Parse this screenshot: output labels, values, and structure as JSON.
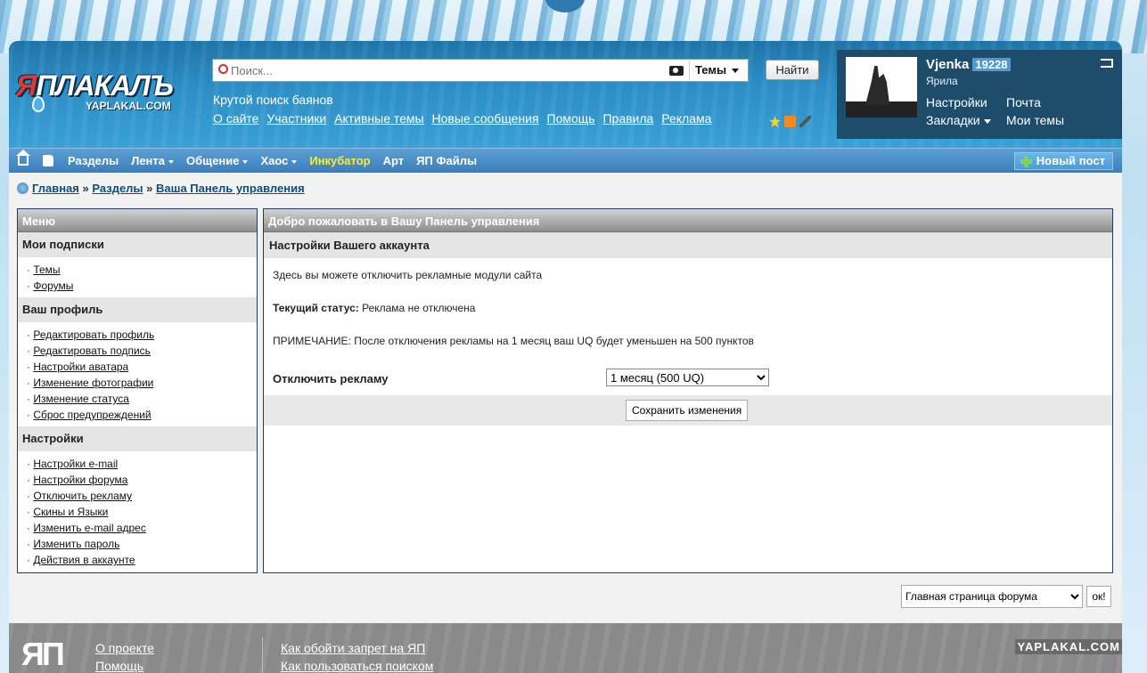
{
  "header": {
    "logo_text_red": "Я",
    "logo_text": "ПЛАКАЛЪ",
    "logo_sub": "YAPLAKAL.COM",
    "search_placeholder": "Поиск...",
    "search_scope": "Темы",
    "search_button": "Найти",
    "tagline": "Крутой поиск баянов",
    "links": [
      "О сайте",
      "Участники",
      "Активные темы",
      "Новые сообщения",
      "Помощь",
      "Правила",
      "Реклама"
    ]
  },
  "user": {
    "name": "Vjenka",
    "reputation": "19228",
    "rank": "Ярила",
    "menu": [
      "Настройки",
      "Почта",
      "Закладки",
      "Мои темы"
    ]
  },
  "nav": {
    "items": [
      {
        "label": "Разделы"
      },
      {
        "label": "Лента"
      },
      {
        "label": "Общение"
      },
      {
        "label": "Хаос"
      },
      {
        "label": "Инкубатор"
      },
      {
        "label": "Арт"
      },
      {
        "label": "ЯП Файлы"
      }
    ],
    "new_post": "Новый пост",
    "highlight_color": "#ffec2a"
  },
  "breadcrumb": [
    "Главная",
    "Разделы",
    "Ваша Панель управления"
  ],
  "menu": {
    "title": "Меню",
    "sections": [
      {
        "title": "Мои подписки",
        "items": [
          "Темы",
          "Форумы"
        ]
      },
      {
        "title": "Ваш профиль",
        "items": [
          "Редактировать профиль",
          "Редактировать подпись",
          "Настройки аватара",
          "Изменение фотографии",
          "Изменение статуса",
          "Сброс предупреждений"
        ]
      },
      {
        "title": "Настройки",
        "items": [
          "Настройки e-mail",
          "Настройки форума",
          "Отключить рекламу",
          "Скины и Языки",
          "Изменить e-mail адрес",
          "Изменить пароль",
          "Действия в аккаунте"
        ]
      }
    ]
  },
  "content": {
    "title": "Добро пожаловать в Вашу Панель управления",
    "subtitle": "Настройки Вашего аккаунта",
    "intro": "Здесь вы можете отключить рекламные модули сайта",
    "status_label": "Текущий статус:",
    "status_value": "Реклама не отключена",
    "note": "ПРИМЕЧАНИЕ: После отключения рекламы на 1 месяц ваш UQ будет уменьшен на 500 пунктов",
    "option_label": "Отключить рекламу",
    "option_value": "1 месяц (500 UQ)",
    "save_button": "Сохранить изменения"
  },
  "jump": {
    "value": "Главная страница форума",
    "button": "ок!"
  },
  "footer": {
    "logo": "ЯП",
    "col1": [
      "О проекте",
      "Помощь"
    ],
    "col2": [
      "Как обойти запрет на ЯП",
      "Как пользоваться поиском"
    ],
    "brand": "YAPLAKAL.COM"
  }
}
